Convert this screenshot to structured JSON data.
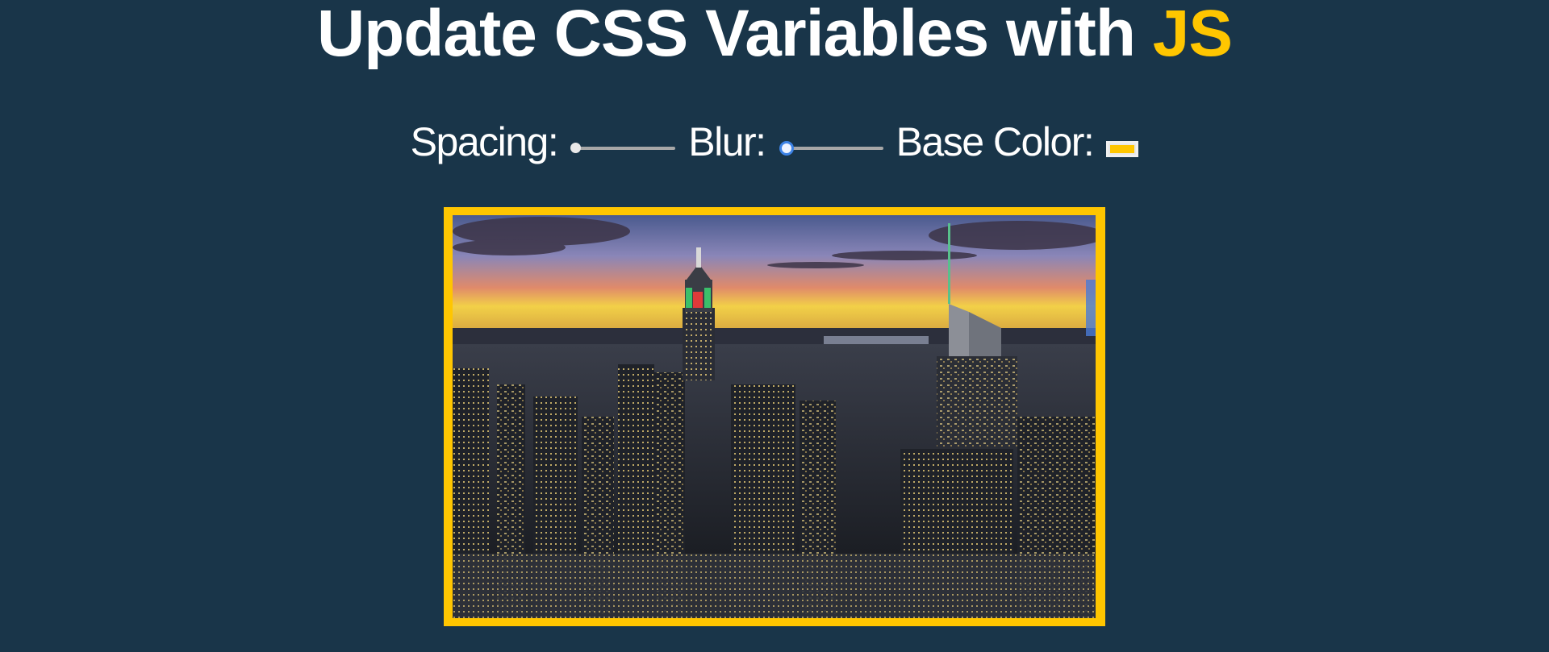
{
  "header": {
    "title_prefix": "Update CSS Variables with ",
    "title_highlight": "JS"
  },
  "controls": {
    "spacing_label": "Spacing:",
    "blur_label": "Blur:",
    "base_color_label": "Base Color:",
    "base_color_value": "#ffc600",
    "spacing_level": 0,
    "blur_level": 0
  },
  "image": {
    "description": "city skyline at dusk"
  },
  "colors": {
    "background": "#193549",
    "accent": "#ffc600",
    "text": "#ffffff"
  }
}
